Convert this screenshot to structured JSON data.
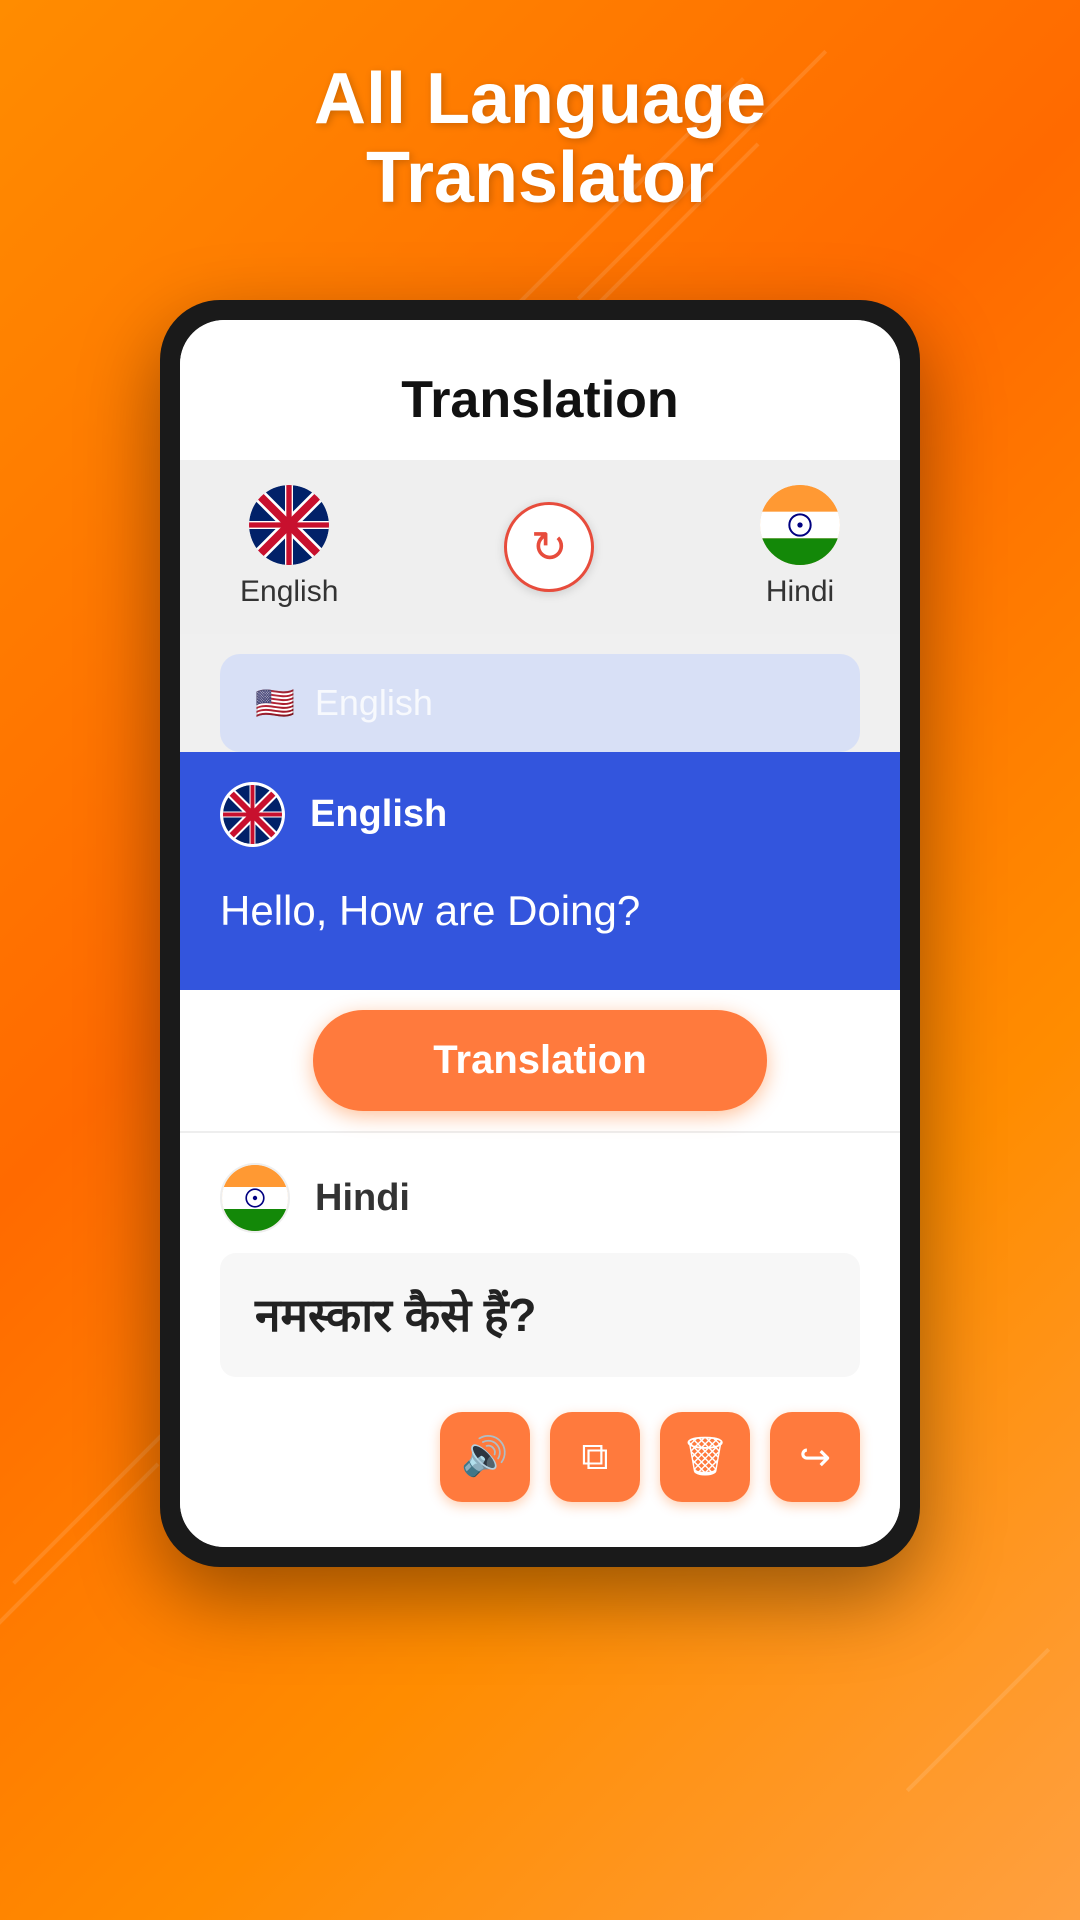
{
  "header": {
    "title_line1": "All Language",
    "title_line2": "Translator"
  },
  "app": {
    "screen_title": "Translation",
    "source_lang": {
      "name": "English",
      "flag_emoji": "🇬🇧"
    },
    "target_lang": {
      "name": "Hindi",
      "flag_emoji": "🇮🇳"
    },
    "input_placeholder": "English",
    "input_text": "Hello, How are Doing?",
    "output_lang": {
      "name": "Hindi",
      "flag_emoji": "🇮🇳"
    },
    "output_text": "नमस्कार कैसे हैं?",
    "translate_button_label": "Translation",
    "swap_icon": "↻"
  },
  "action_buttons": [
    {
      "name": "volume-button",
      "icon": "🔊"
    },
    {
      "name": "copy-button",
      "icon": "⧉"
    },
    {
      "name": "delete-button",
      "icon": "🗑"
    },
    {
      "name": "share-button",
      "icon": "↪"
    }
  ]
}
